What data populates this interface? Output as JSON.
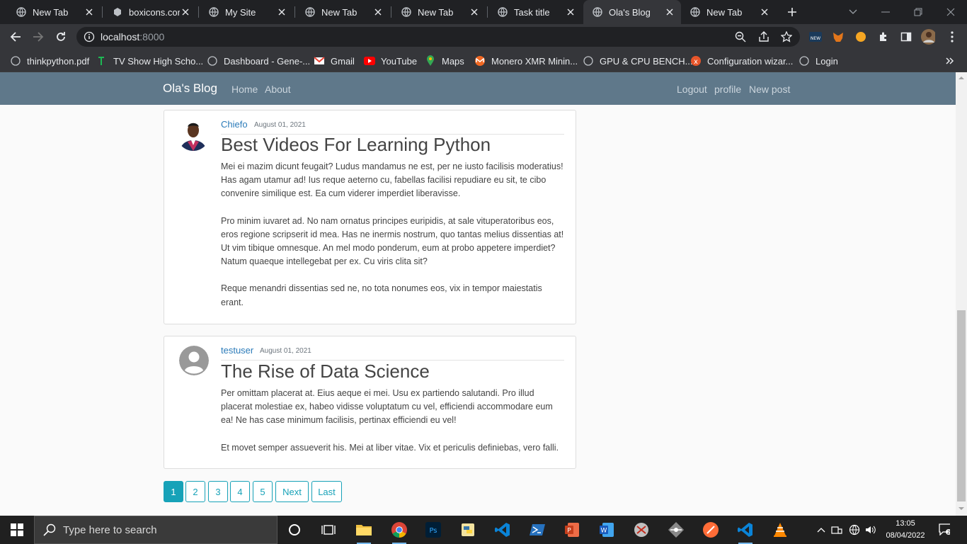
{
  "browser": {
    "tabs": [
      {
        "title": "New Tab"
      },
      {
        "title": "boxicons.com"
      },
      {
        "title": "My Site"
      },
      {
        "title": "New Tab"
      },
      {
        "title": "New Tab"
      },
      {
        "title": "Task title"
      },
      {
        "title": "Ola's Blog",
        "active": true
      },
      {
        "title": "New Tab"
      }
    ],
    "url": {
      "host": "localhost",
      "port": ":8000"
    },
    "bookmarks": [
      "thinkpython.pdf",
      "TV Show High Scho...",
      "Dashboard - Gene-...",
      "Gmail",
      "YouTube",
      "Maps",
      "Monero XMR Minin...",
      "GPU & CPU BENCH...",
      "Configuration wizar...",
      "Login"
    ]
  },
  "site": {
    "brand": "Ola's Blog",
    "nav_left": [
      "Home",
      "About"
    ],
    "nav_right": [
      "Logout",
      "profile",
      "New post"
    ]
  },
  "posts": [
    {
      "author": "Chiefo",
      "date": "August 01, 2021",
      "title": "Best Videos For Learning Python",
      "paragraphs": [
        "Mei ei mazim dicunt feugait? Ludus mandamus ne est, per ne iusto facilisis moderatius! Has agam utamur ad! Ius reque aeterno cu, fabellas facilisi repudiare eu sit, te cibo convenire similique est. Ea cum viderer imperdiet liberavisse.",
        "Pro minim iuvaret ad. No nam ornatus principes euripidis, at sale vituperatoribus eos, eros regione scripserit id mea. Has ne inermis nostrum, quo tantas melius dissentias at! Ut vim tibique omnesque. An mel modo ponderum, eum at probo appetere imperdiet? Natum quaeque intellegebat per ex. Cu viris clita sit?",
        "Reque menandri dissentias sed ne, no tota nonumes eos, vix in tempor maiestatis erant."
      ]
    },
    {
      "author": "testuser",
      "date": "August 01, 2021",
      "title": "The Rise of Data Science",
      "paragraphs": [
        "Per omittam placerat at. Eius aeque ei mei. Usu ex partiendo salutandi. Pro illud placerat molestiae ex, habeo vidisse voluptatum cu vel, efficiendi accommodare eum ea! Ne has case minimum facilisis, pertinax efficiendi eu vel!",
        "Et movet semper assueverit his. Mei at liber vitae. Vix et periculis definiebas, vero falli."
      ]
    }
  ],
  "pagination": {
    "pages": [
      "1",
      "2",
      "3",
      "4",
      "5"
    ],
    "active_page": "1",
    "next": "Next",
    "last": "Last"
  },
  "taskbar": {
    "search_placeholder": "Type here to search",
    "time": "13:05",
    "date": "08/04/2022"
  },
  "colors": {
    "site_nav": "#5f788a",
    "pager_accent": "#17a2b8",
    "author_link": "#2b7bb9"
  }
}
